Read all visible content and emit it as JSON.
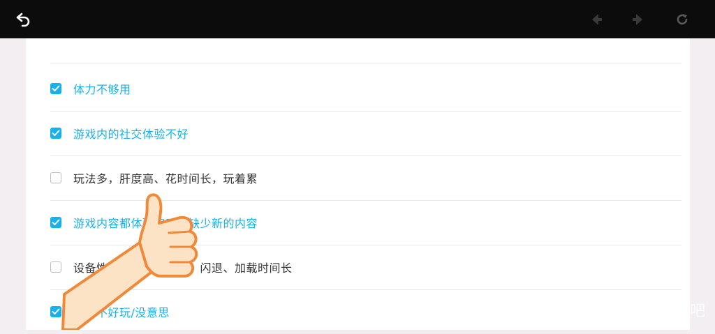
{
  "toolbar": {
    "back_icon": "back-arrow-icon",
    "prev_icon": "arrow-left-icon",
    "next_icon": "arrow-right-icon",
    "refresh_icon": "refresh-icon"
  },
  "colors": {
    "accent": "#14b1ec",
    "topbar": "#0c0c0c",
    "unchecked_text": "#333333"
  },
  "options": [
    {
      "label": "体力不够用",
      "checked": true
    },
    {
      "label": "游戏内的社交体验不好",
      "checked": true
    },
    {
      "label": "玩法多，肝度高、花时间长，玩着累",
      "checked": false
    },
    {
      "label": "游戏内容都体验完了，缺少新的内容",
      "checked": true
    },
    {
      "label": "设备性能问题，如卡顿、闪退、加载时间长",
      "checked": false
    },
    {
      "label": "活动不好玩/没意思",
      "checked": true
    }
  ],
  "watermark": "吧"
}
